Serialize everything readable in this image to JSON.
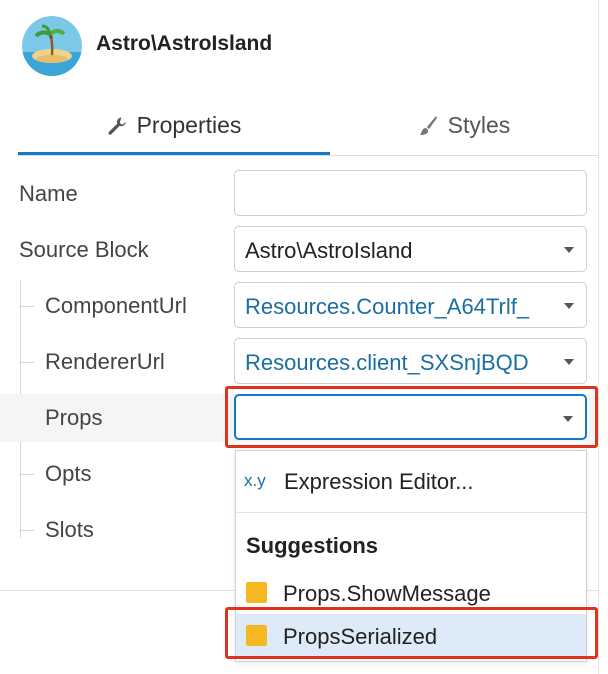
{
  "header": {
    "title": "Astro\\AstroIsland",
    "avatar_icon": "island-icon"
  },
  "tabs": [
    {
      "label": "Properties",
      "icon": "wrench-icon",
      "active": true
    },
    {
      "label": "Styles",
      "icon": "brush-icon",
      "active": false
    }
  ],
  "fields": {
    "name": {
      "label": "Name",
      "value": ""
    },
    "source_block": {
      "label": "Source Block",
      "value": "Astro\\AstroIsland"
    },
    "component_url": {
      "label": "ComponentUrl",
      "value": "Resources.Counter_A64Trlf_"
    },
    "renderer_url": {
      "label": "RendererUrl",
      "value": "Resources.client_SXSnjBQD"
    },
    "props": {
      "label": "Props",
      "value": ""
    },
    "opts": {
      "label": "Opts"
    },
    "slots": {
      "label": "Slots"
    }
  },
  "dropdown": {
    "expression_badge": "x.y",
    "expression_label": "Expression Editor...",
    "suggestions_heading": "Suggestions",
    "items": [
      {
        "label": "Props.ShowMessage",
        "selected": false
      },
      {
        "label": "PropsSerialized",
        "selected": true
      }
    ]
  },
  "colors": {
    "accent": "#1478c8",
    "highlight": "#e0321c",
    "suggestion_square": "#f5b822"
  }
}
